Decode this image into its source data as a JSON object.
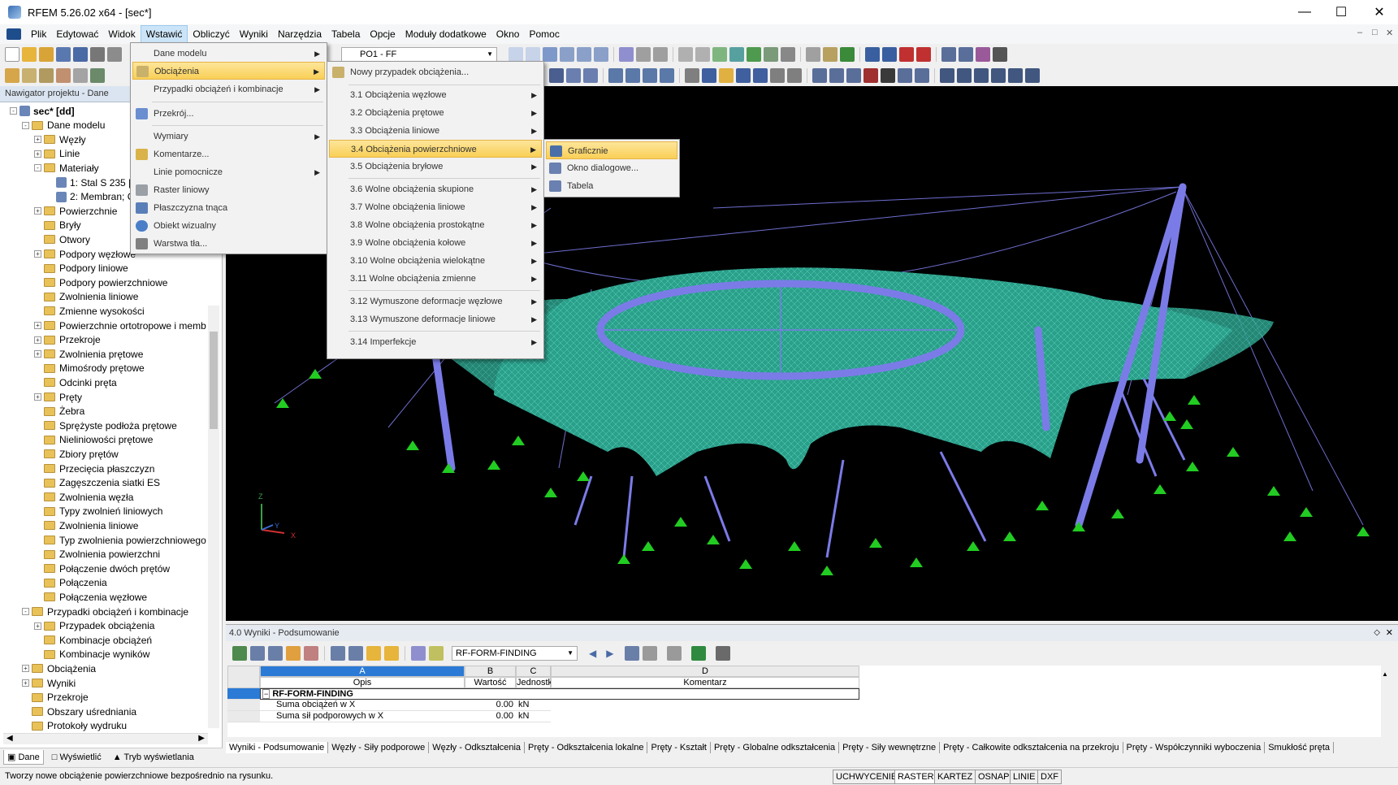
{
  "app": {
    "title": "RFEM 5.26.02 x64 - [sec*]"
  },
  "menubar": [
    "Plik",
    "Edytować",
    "Widok",
    "Wstawić",
    "Obliczyć",
    "Wyniki",
    "Narzędzia",
    "Tabela",
    "Opcje",
    "Moduły dodatkowe",
    "Okno",
    "Pomoc"
  ],
  "toolbar": {
    "load_case": "PO1 - FF"
  },
  "navigator": {
    "header": "Nawigator projektu - Dane",
    "tree": [
      {
        "label": "sec* [dd]",
        "level": 0,
        "exp": "-",
        "bold": true
      },
      {
        "label": "Dane modelu",
        "level": 1,
        "exp": "-"
      },
      {
        "label": "Węzły",
        "level": 2,
        "exp": "+"
      },
      {
        "label": "Linie",
        "level": 2,
        "exp": "+"
      },
      {
        "label": "Materiały",
        "level": 2,
        "exp": "-"
      },
      {
        "label": "1: Stal S 235 |",
        "level": 3,
        "exp": ""
      },
      {
        "label": "2: Membran; C",
        "level": 3,
        "exp": ""
      },
      {
        "label": "Powierzchnie",
        "level": 2,
        "exp": "+"
      },
      {
        "label": "Bryły",
        "level": 2,
        "exp": ""
      },
      {
        "label": "Otwory",
        "level": 2,
        "exp": ""
      },
      {
        "label": "Podpory węzłowe",
        "level": 2,
        "exp": "+"
      },
      {
        "label": "Podpory liniowe",
        "level": 2,
        "exp": ""
      },
      {
        "label": "Podpory powierzchniowe",
        "level": 2,
        "exp": ""
      },
      {
        "label": "Zwolnienia liniowe",
        "level": 2,
        "exp": ""
      },
      {
        "label": "Zmienne wysokości",
        "level": 2,
        "exp": ""
      },
      {
        "label": "Powierzchnie ortotropowe i memb",
        "level": 2,
        "exp": "+"
      },
      {
        "label": "Przekroje",
        "level": 2,
        "exp": "+"
      },
      {
        "label": "Zwolnienia prętowe",
        "level": 2,
        "exp": "+"
      },
      {
        "label": "Mimośrody prętowe",
        "level": 2,
        "exp": ""
      },
      {
        "label": "Odcinki pręta",
        "level": 2,
        "exp": ""
      },
      {
        "label": "Pręty",
        "level": 2,
        "exp": "+"
      },
      {
        "label": "Żebra",
        "level": 2,
        "exp": ""
      },
      {
        "label": "Sprężyste podłoża prętowe",
        "level": 2,
        "exp": ""
      },
      {
        "label": "Nieliniowości prętowe",
        "level": 2,
        "exp": ""
      },
      {
        "label": "Zbiory prętów",
        "level": 2,
        "exp": ""
      },
      {
        "label": "Przecięcia płaszczyzn",
        "level": 2,
        "exp": ""
      },
      {
        "label": "Zagęszczenia siatki ES",
        "level": 2,
        "exp": ""
      },
      {
        "label": "Zwolnienia węzła",
        "level": 2,
        "exp": ""
      },
      {
        "label": "Typy zwolnień liniowych",
        "level": 2,
        "exp": ""
      },
      {
        "label": "Zwolnienia liniowe",
        "level": 2,
        "exp": ""
      },
      {
        "label": "Typ zwolnienia powierzchniowego",
        "level": 2,
        "exp": ""
      },
      {
        "label": "Zwolnienia powierzchni",
        "level": 2,
        "exp": ""
      },
      {
        "label": "Połączenie dwóch prętów",
        "level": 2,
        "exp": ""
      },
      {
        "label": "Połączenia",
        "level": 2,
        "exp": ""
      },
      {
        "label": "Połączenia węzłowe",
        "level": 2,
        "exp": ""
      },
      {
        "label": "Przypadki obciążeń i kombinacje",
        "level": 1,
        "exp": "-"
      },
      {
        "label": "Przypadek obciążenia",
        "level": 2,
        "exp": "+"
      },
      {
        "label": "Kombinacje obciążeń",
        "level": 2,
        "exp": ""
      },
      {
        "label": "Kombinacje wyników",
        "level": 2,
        "exp": ""
      },
      {
        "label": "Obciążenia",
        "level": 1,
        "exp": "+"
      },
      {
        "label": "Wyniki",
        "level": 1,
        "exp": "+"
      },
      {
        "label": "Przekroje",
        "level": 1,
        "exp": ""
      },
      {
        "label": "Obszary uśredniania",
        "level": 1,
        "exp": ""
      },
      {
        "label": "Protokoły wydruku",
        "level": 1,
        "exp": ""
      }
    ],
    "tabs": [
      "Dane",
      "Wyświetlić",
      "Tryb wyświetlania"
    ]
  },
  "menu_insert": {
    "items": [
      "Dane modelu",
      "Obciążenia",
      "Przypadki obciążeń i kombinacje",
      "Przekrój...",
      "Wymiary",
      "Komentarze...",
      "Linie pomocnicze",
      "Raster liniowy",
      "Płaszczyzna tnąca",
      "Obiekt wizualny",
      "Warstwa tła..."
    ]
  },
  "menu_loads": {
    "items": [
      "Nowy przypadek obciążenia...",
      "3.1 Obciążenia węzłowe",
      "3.2 Obciążenia prętowe",
      "3.3 Obciążenia liniowe",
      "3.4 Obciążenia powierzchniowe",
      "3.5 Obciążenia bryłowe",
      "3.6 Wolne obciążenia skupione",
      "3.7 Wolne obciążenia liniowe",
      "3.8 Wolne obciążenia prostokątne",
      "3.9 Wolne obciążenia kołowe",
      "3.10 Wolne obciążenia wielokątne",
      "3.11 Wolne obciążenia zmienne",
      "3.12 Wymuszone deformacje węzłowe",
      "3.13 Wymuszone deformacje liniowe",
      "3.14 Imperfekcje"
    ]
  },
  "menu_surface": {
    "items": [
      "Graficznie",
      "Okno dialogowe...",
      "Tabela"
    ]
  },
  "results": {
    "header": "4.0 Wyniki - Podsumowanie",
    "combo": "RF-FORM-FINDING",
    "col_letters": [
      "A",
      "B",
      "C",
      "D"
    ],
    "col_titles": [
      "Opis",
      "Wartość",
      "Jednostk",
      "Komentarz"
    ],
    "group": "RF-FORM-FINDING",
    "rows": [
      {
        "desc": "Suma obciążeń w X",
        "value": "0.00",
        "unit": "kN"
      },
      {
        "desc": "Suma sił podporowych w X",
        "value": "0.00",
        "unit": "kN"
      }
    ],
    "tabs": [
      "Wyniki - Podsumowanie",
      "Węzły - Siły podporowe",
      "Węzły - Odkształcenia",
      "Pręty - Odkształcenia lokalne",
      "Pręty - Kształt",
      "Pręty - Globalne odkształcenia",
      "Pręty - Siły wewnętrzne",
      "Pręty - Całkowite odkształcenia na przekroju",
      "Pręty - Współczynniki wyboczenia",
      "Smukłość pręta"
    ]
  },
  "statusbar": {
    "text": "Tworzy nowe obciążenie powierzchniowe bezpośrednio na rysunku.",
    "buttons": [
      "UCHWYCENIE",
      "RASTER",
      "KARTEZ",
      "OSNAP",
      "LINIE",
      "DXF"
    ]
  },
  "axes": {
    "z": "Z",
    "y": "Y",
    "x": "X"
  },
  "colors": {
    "membrane": "#2a9f8a",
    "members": "#7b7be8",
    "supports": "#22cc22",
    "menu_highlight": "#f9cf56"
  }
}
